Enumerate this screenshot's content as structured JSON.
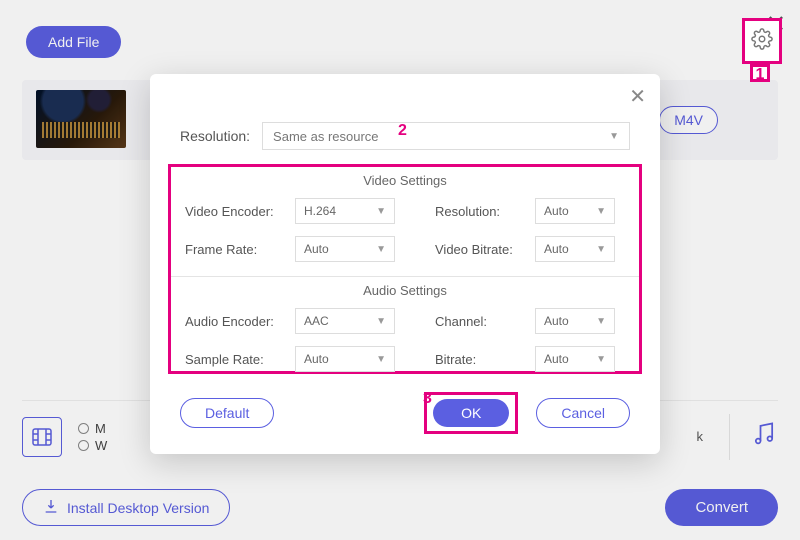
{
  "header": {
    "add_file": "Add File"
  },
  "file_row": {
    "format_button": "M4V"
  },
  "annotations": {
    "one": "1",
    "two": "2",
    "three": "3"
  },
  "modal": {
    "resolution_label": "Resolution:",
    "resolution_value": "Same as resource",
    "video_settings_title": "Video Settings",
    "audio_settings_title": "Audio Settings",
    "video": {
      "encoder_label": "Video Encoder:",
      "encoder_value": "H.264",
      "frame_rate_label": "Frame Rate:",
      "frame_rate_value": "Auto",
      "resolution_label": "Resolution:",
      "resolution_value": "Auto",
      "bitrate_label": "Video Bitrate:",
      "bitrate_value": "Auto"
    },
    "audio": {
      "encoder_label": "Audio Encoder:",
      "encoder_value": "AAC",
      "sample_rate_label": "Sample Rate:",
      "sample_rate_value": "Auto",
      "channel_label": "Channel:",
      "channel_value": "Auto",
      "bitrate_label": "Bitrate:",
      "bitrate_value": "Auto"
    },
    "default_btn": "Default",
    "ok_btn": "OK",
    "cancel_btn": "Cancel"
  },
  "bottom": {
    "radio1": "M",
    "radio2": "W",
    "right_letter": "k"
  },
  "footer": {
    "install": "Install Desktop Version",
    "convert": "Convert"
  }
}
